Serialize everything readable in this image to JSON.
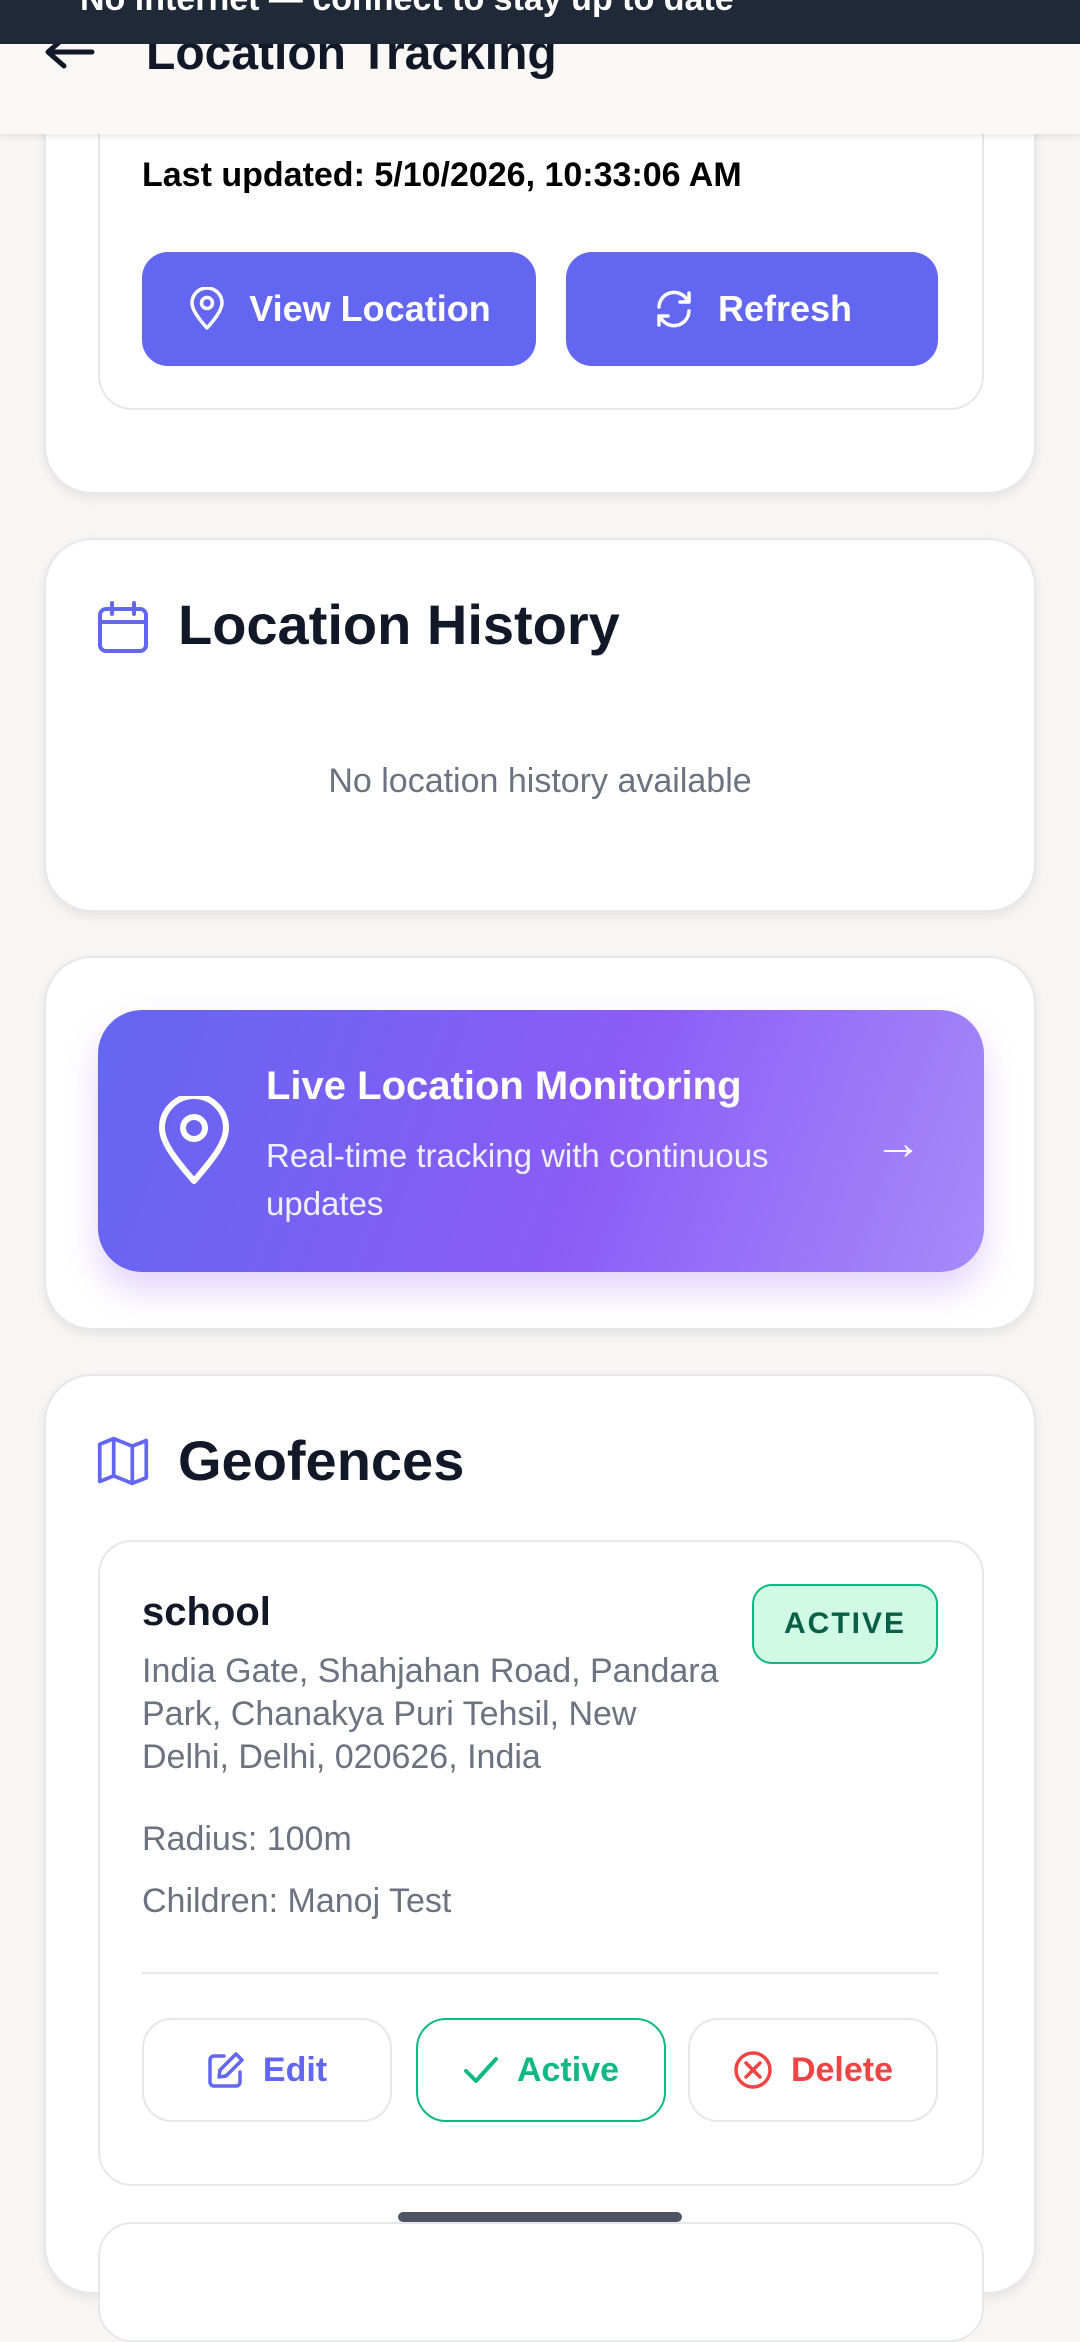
{
  "status_bar": {
    "text": "No internet — connect to stay up to date"
  },
  "header": {
    "title": "Location Tracking"
  },
  "current_location": {
    "last_updated": "Last updated: 5/10/2026, 10:33:06 AM",
    "view_location_label": "View Location",
    "refresh_label": "Refresh"
  },
  "history": {
    "title": "Location History",
    "empty_text": "No location history available"
  },
  "live_monitoring": {
    "title": "Live Location Monitoring",
    "subtitle": "Real-time tracking with continuous updates",
    "arrow": "→"
  },
  "geofences": {
    "title": "Geofences",
    "items": [
      {
        "name": "school",
        "status": "ACTIVE",
        "address_lines": [
          "India Gate, Shahjahan Road, Pandara",
          "Park, Chanakya Puri Tehsil, New",
          "Delhi, Delhi, 020626, India"
        ],
        "radius": "Radius: 100m",
        "children": "Children: Manoj Test",
        "edit_label": "Edit",
        "active_label": "Active",
        "delete_label": "Delete"
      }
    ]
  },
  "colors": {
    "primary": "#6366f1",
    "success": "#10b981",
    "danger": "#ef4444",
    "muted_text": "#6b7280"
  }
}
